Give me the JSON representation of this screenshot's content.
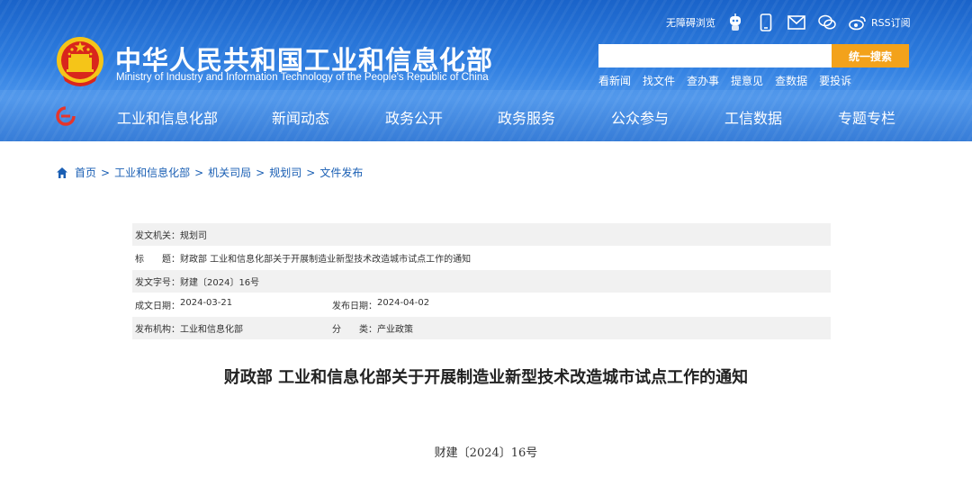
{
  "header": {
    "site_title": "中华人民共和国工业和信息化部",
    "site_subtitle": "Ministry of Industry and Information Technology of the People's Republic of China",
    "accessibility_label": "无障碍浏览",
    "rss_label": "RSS订阅",
    "search_placeholder": "",
    "search_button": "统一搜索",
    "quick_links": [
      "看新闻",
      "找文件",
      "查办事",
      "提意见",
      "查数据",
      "要投诉"
    ]
  },
  "nav": {
    "items": [
      "工业和信息化部",
      "新闻动态",
      "政务公开",
      "政务服务",
      "公众参与",
      "工信数据",
      "专题专栏"
    ]
  },
  "breadcrumb": {
    "items": [
      "首页",
      "工业和信息化部",
      "机关司局",
      "规划司",
      "文件发布"
    ],
    "separator": ">"
  },
  "meta": {
    "issuer_label": "发文机关：",
    "issuer": "规划司",
    "title_label": "标　　题：",
    "title": "财政部 工业和信息化部关于开展制造业新型技术改造城市试点工作的通知",
    "doc_no_label": "发文字号：",
    "doc_no": "财建〔2024〕16号",
    "created_label": "成文日期：",
    "created": "2024-03-21",
    "published_label": "发布日期：",
    "published": "2024-04-02",
    "org_label": "发布机构：",
    "org": "工业和信息化部",
    "category_label": "分　　类：",
    "category": "产业政策"
  },
  "article": {
    "title": "财政部 工业和信息化部关于开展制造业新型技术改造城市试点工作的通知",
    "doc_number": "财建〔2024〕16号"
  },
  "colors": {
    "header_blue": "#2f7ee0",
    "search_button": "#f3a21b",
    "link_blue": "#1a5fb4",
    "emblem_red": "#d9261c",
    "emblem_gold": "#f5c518"
  }
}
